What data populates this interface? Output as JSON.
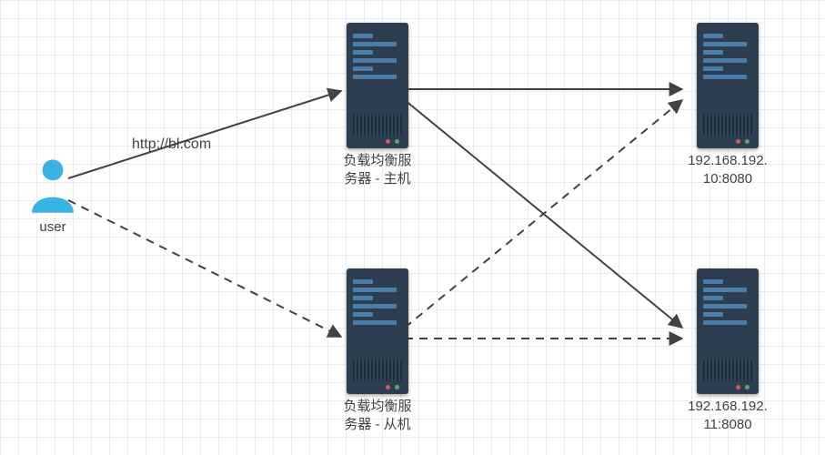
{
  "nodes": {
    "user": {
      "label": "user"
    },
    "lb_primary": {
      "label": "负载均衡服\n务器 - 主机"
    },
    "lb_backup": {
      "label": "负载均衡服\n务器 - 从机"
    },
    "srv1": {
      "label": "192.168.192.\n10:8080"
    },
    "srv2": {
      "label": "192.168.192.\n11:8080"
    }
  },
  "edges": {
    "user_to_primary": {
      "label": "http://bl.com"
    }
  },
  "colors": {
    "user": "#38B3E3",
    "server_body": "#2d3e50",
    "server_bar": "#4a7ea8"
  }
}
